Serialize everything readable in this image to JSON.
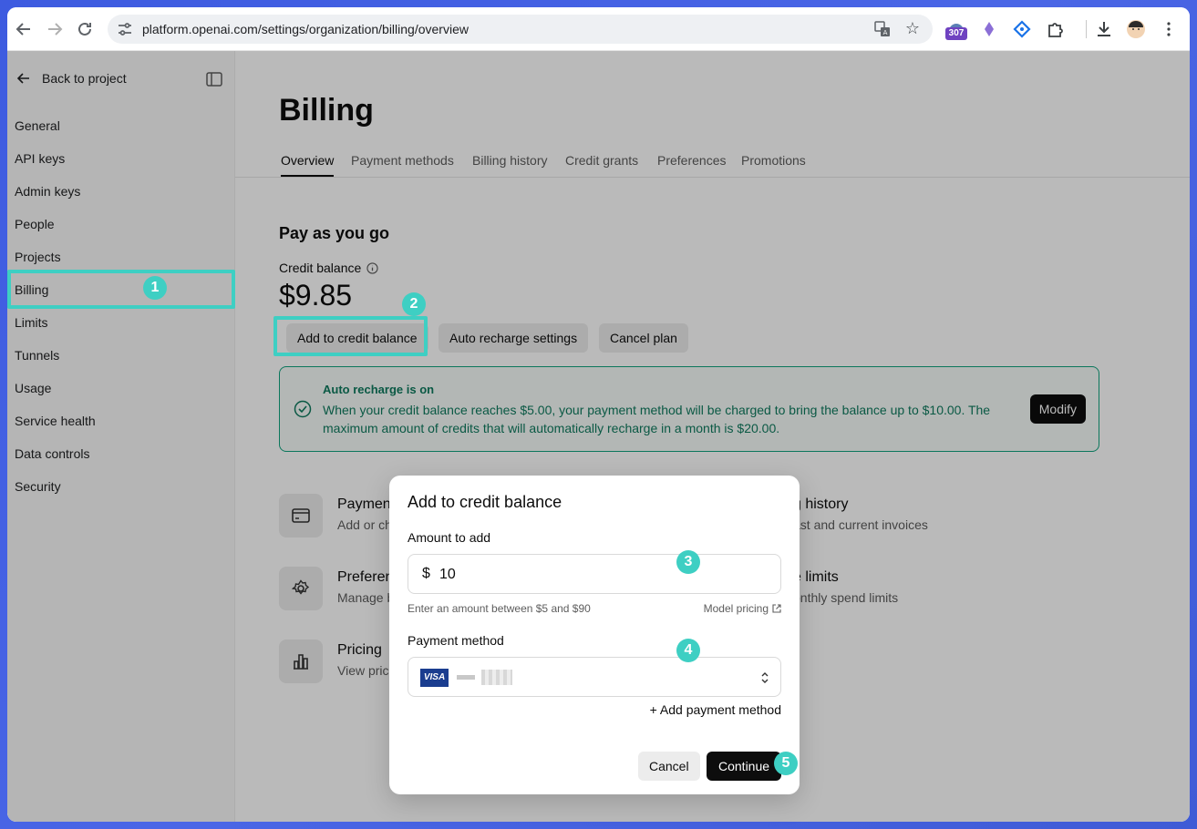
{
  "browser": {
    "url": "platform.openai.com/settings/organization/billing/overview",
    "extension_badge": "307"
  },
  "sidebar": {
    "back_label": "Back to project",
    "items": [
      {
        "label": "General"
      },
      {
        "label": "API keys"
      },
      {
        "label": "Admin keys"
      },
      {
        "label": "People"
      },
      {
        "label": "Projects"
      },
      {
        "label": "Billing"
      },
      {
        "label": "Limits"
      },
      {
        "label": "Tunnels"
      },
      {
        "label": "Usage"
      },
      {
        "label": "Service health"
      },
      {
        "label": "Data controls"
      },
      {
        "label": "Security"
      }
    ]
  },
  "main": {
    "title": "Billing",
    "tabs": [
      {
        "label": "Overview"
      },
      {
        "label": "Payment methods"
      },
      {
        "label": "Billing history"
      },
      {
        "label": "Credit grants"
      },
      {
        "label": "Preferences"
      },
      {
        "label": "Promotions"
      }
    ],
    "section_title": "Pay as you go",
    "credit_label": "Credit balance",
    "balance": "$9.85",
    "buttons": {
      "add_credit": "Add to credit balance",
      "auto_recharge": "Auto recharge settings",
      "cancel_plan": "Cancel plan"
    },
    "recharge": {
      "title": "Auto recharge is on",
      "text": "When your credit balance reaches $5.00, your payment method will be charged to bring the balance up to $10.00. The maximum amount of credits that will automatically recharge in a month is $20.00.",
      "modify": "Modify"
    },
    "cards": [
      {
        "title": "Paymen",
        "subtitle": "Add or ch"
      },
      {
        "title": "g history",
        "subtitle": "ast and current invoices"
      },
      {
        "title": "Preferen",
        "subtitle": "Manage b"
      },
      {
        "title": "e limits",
        "subtitle": "onthly spend limits"
      },
      {
        "title": "Pricing",
        "subtitle": "View pric"
      }
    ]
  },
  "modal": {
    "title": "Add to credit balance",
    "amount_label": "Amount to add",
    "currency_symbol": "$",
    "amount_value": "10",
    "hint": "Enter an amount between $5 and $90",
    "model_pricing": "Model pricing",
    "payment_label": "Payment method",
    "card_brand": "VISA",
    "add_payment": "+ Add payment method",
    "cancel": "Cancel",
    "continue": "Continue"
  },
  "annotations": {
    "step_numbers": [
      "1",
      "2",
      "3",
      "4",
      "5"
    ],
    "color": "#3ecfc3"
  }
}
